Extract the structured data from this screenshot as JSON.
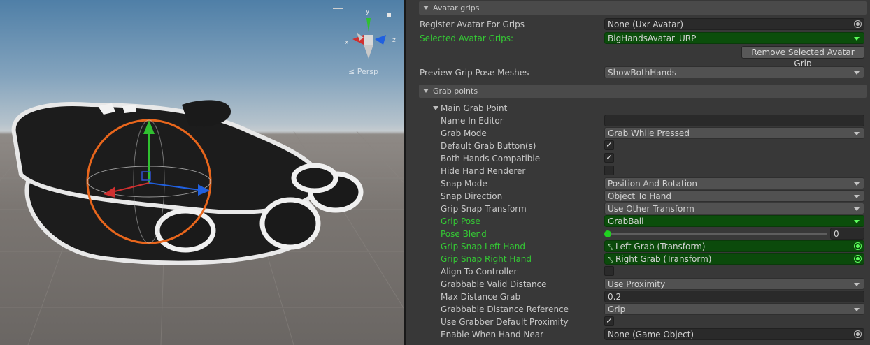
{
  "scene": {
    "projection_label": "≤ Persp",
    "gizmo_axes": {
      "x": "x",
      "y": "y",
      "z": "z"
    }
  },
  "inspector": {
    "avatar_grips_header": "Avatar grips",
    "register_avatar": {
      "label": "Register Avatar For Grips",
      "value": "None (Uxr Avatar)"
    },
    "selected_grips": {
      "label": "Selected Avatar Grips:",
      "value": "BigHandsAvatar_URP"
    },
    "remove_button": "Remove Selected Avatar Grip",
    "preview_meshes": {
      "label": "Preview Grip Pose Meshes",
      "value": "ShowBothHands"
    },
    "grab_points_header": "Grab points",
    "main_grab_point": "Main Grab Point",
    "fields": {
      "name_in_editor": {
        "label": "Name In Editor",
        "value": ""
      },
      "grab_mode": {
        "label": "Grab Mode",
        "value": "Grab While Pressed"
      },
      "default_grab_buttons": {
        "label": "Default Grab Button(s)",
        "checked": "✓"
      },
      "both_hands_compatible": {
        "label": "Both Hands Compatible",
        "checked": "✓"
      },
      "hide_hand_renderer": {
        "label": "Hide Hand Renderer",
        "checked": ""
      },
      "snap_mode": {
        "label": "Snap Mode",
        "value": "Position And Rotation"
      },
      "snap_direction": {
        "label": "Snap Direction",
        "value": "Object To Hand"
      },
      "grip_snap_transform": {
        "label": "Grip Snap Transform",
        "value": "Use Other Transform"
      },
      "grip_pose": {
        "label": "Grip Pose",
        "value": "GrabBall"
      },
      "pose_blend": {
        "label": "Pose Blend",
        "value": "0",
        "fraction": 0
      },
      "grip_snap_left": {
        "label": "Grip Snap Left Hand",
        "value": "Left Grab (Transform)"
      },
      "grip_snap_right": {
        "label": "Grip Snap Right Hand",
        "value": "Right Grab (Transform)"
      },
      "align_to_controller": {
        "label": "Align To Controller",
        "checked": ""
      },
      "valid_distance": {
        "label": "Grabbable Valid Distance",
        "value": "Use Proximity"
      },
      "max_distance": {
        "label": "Max Distance Grab",
        "value": "0.2"
      },
      "distance_reference": {
        "label": "Grabbable Distance Reference",
        "value": "Grip"
      },
      "use_grabber_proximity": {
        "label": "Use Grabber Default Proximity",
        "checked": "✓"
      },
      "enable_when_near": {
        "label": "Enable When Hand Near",
        "value": "None (Game Object)"
      }
    }
  },
  "colors": {
    "modified_green": "#34c934",
    "selection_green": "#0b4e0b",
    "panel_bg": "#383838",
    "gizmo_x": "#d03030",
    "gizmo_y": "#30c030",
    "gizmo_z": "#2060e0",
    "selection_orange": "#e8661c"
  }
}
